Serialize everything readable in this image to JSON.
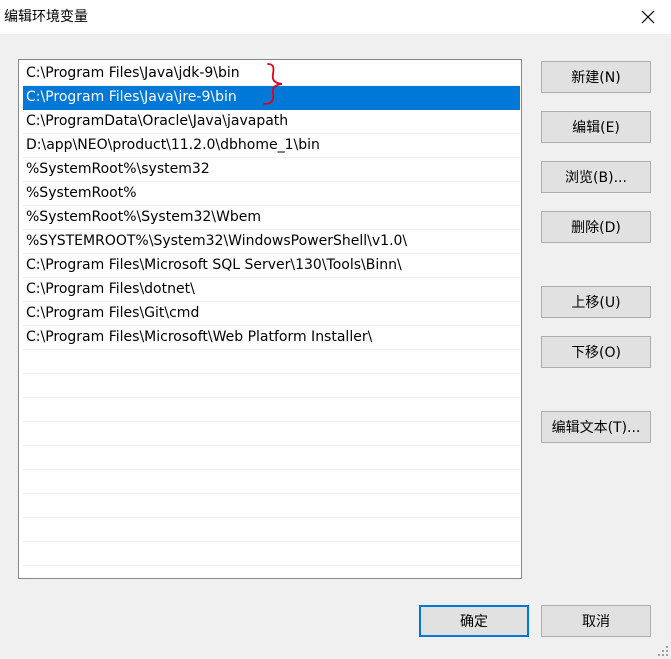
{
  "window": {
    "title": "编辑环境变量"
  },
  "list": {
    "selected_index": 1,
    "items": [
      "C:\\Program Files\\Java\\jdk-9\\bin",
      "C:\\Program Files\\Java\\jre-9\\bin",
      "C:\\ProgramData\\Oracle\\Java\\javapath",
      "D:\\app\\NEO\\product\\11.2.0\\dbhome_1\\bin",
      "%SystemRoot%\\system32",
      "%SystemRoot%",
      "%SystemRoot%\\System32\\Wbem",
      "%SYSTEMROOT%\\System32\\WindowsPowerShell\\v1.0\\",
      "C:\\Program Files\\Microsoft SQL Server\\130\\Tools\\Binn\\",
      "C:\\Program Files\\dotnet\\",
      "C:\\Program Files\\Git\\cmd",
      "C:\\Program Files\\Microsoft\\Web Platform Installer\\"
    ]
  },
  "buttons": {
    "new": "新建(N)",
    "edit": "编辑(E)",
    "browse": "浏览(B)...",
    "delete": "删除(D)",
    "move_up": "上移(U)",
    "move_down": "下移(O)",
    "edit_text": "编辑文本(T)...",
    "ok": "确定",
    "cancel": "取消"
  },
  "colors": {
    "selection": "#0078d7",
    "annotation": "#e0001a"
  }
}
